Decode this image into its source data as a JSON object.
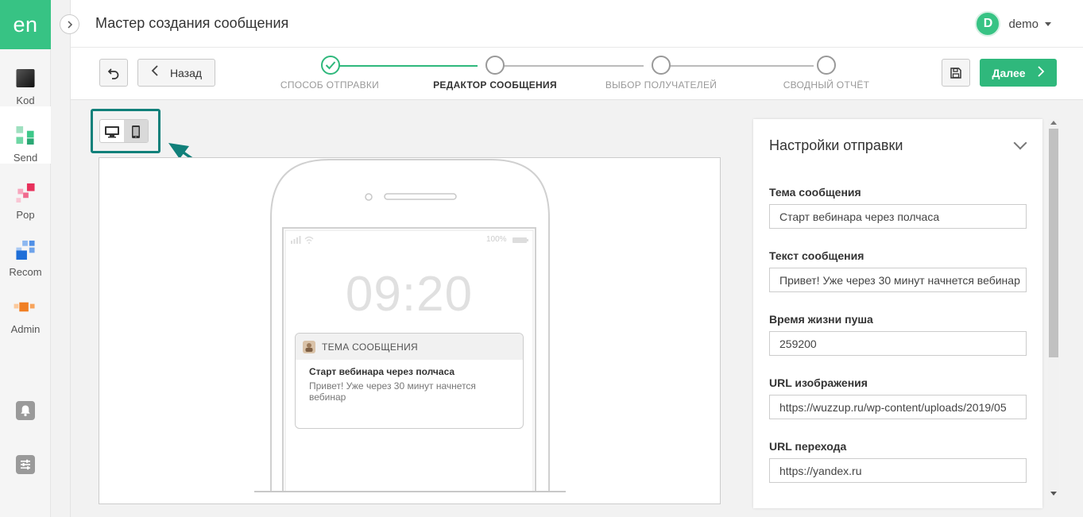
{
  "brand": {
    "logo_text": "en",
    "accent": "#37c384"
  },
  "rail": {
    "items": [
      {
        "label": "Kod",
        "icon": "kod-icon"
      },
      {
        "label": "Send",
        "icon": "send-icon"
      },
      {
        "label": "Pop",
        "icon": "pop-icon"
      },
      {
        "label": "Recom",
        "icon": "recom-icon"
      },
      {
        "label": "Admin",
        "icon": "admin-icon"
      }
    ],
    "bottom_icons": [
      "bell-icon",
      "sliders-icon"
    ]
  },
  "header": {
    "title": "Мастер создания сообщения",
    "user": {
      "initial": "D",
      "name": "demo"
    }
  },
  "toolbar": {
    "back_label": "Назад",
    "next_label": "Далее",
    "steps": [
      {
        "label": "СПОСОБ ОТПРАВКИ",
        "status": "done"
      },
      {
        "label": "РЕДАКТОР СООБЩЕНИЯ",
        "status": "current"
      },
      {
        "label": "ВЫБОР ПОЛУЧАТЕЛЕЙ",
        "status": "todo"
      },
      {
        "label": "СВОДНЫЙ ОТЧЁТ",
        "status": "todo"
      }
    ]
  },
  "preview": {
    "view_mode": "mobile",
    "phone": {
      "battery": "100%",
      "time": "09:20",
      "notification": {
        "header": "ТЕМА СООБЩЕНИЯ",
        "title": "Старт вебинара через полчаса",
        "body_line1": "Привет! Уже через 30 минут начнется",
        "body_line2": "вебинар"
      }
    }
  },
  "settings": {
    "title": "Настройки отправки",
    "fields": [
      {
        "label": "Тема сообщения",
        "value": "Старт вебинара через полчаса"
      },
      {
        "label": "Текст сообщения",
        "value": "Привет! Уже через 30 минут начнется вебинар"
      },
      {
        "label": "Время жизни пуша",
        "value": "259200"
      },
      {
        "label": "URL изображения",
        "value": "https://wuzzup.ru/wp-content/uploads/2019/05"
      },
      {
        "label": "URL перехода",
        "value": "https://yandex.ru"
      }
    ]
  }
}
